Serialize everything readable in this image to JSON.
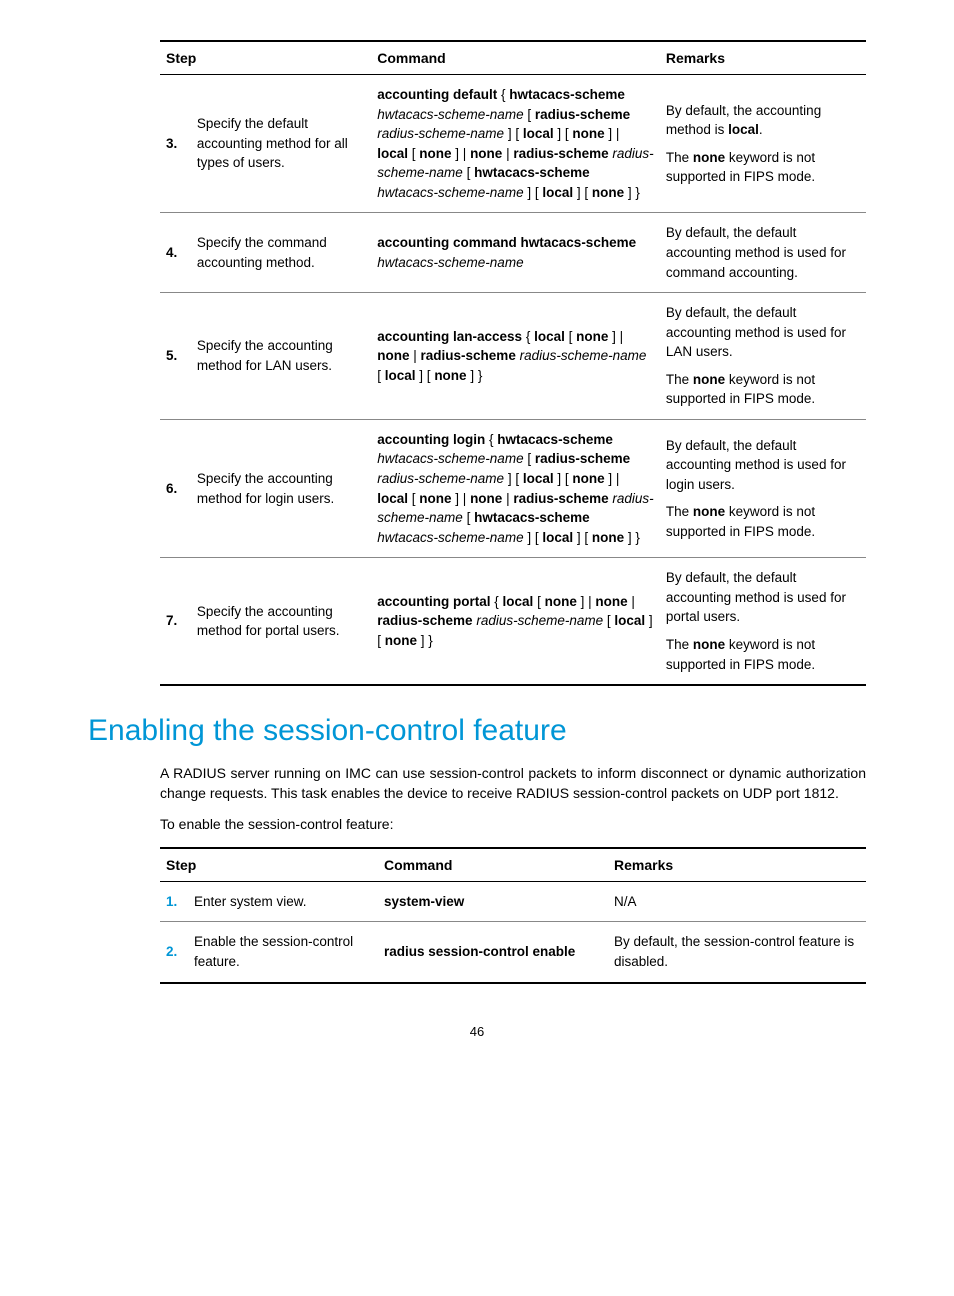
{
  "table1": {
    "headers": {
      "step": "Step",
      "command": "Command",
      "remarks": "Remarks"
    },
    "rows": [
      {
        "num": "3.",
        "desc": "Specify the default accounting method for all types of users.",
        "cmd_segments": [
          {
            "t": "accounting default",
            "b": true
          },
          {
            "t": " { "
          },
          {
            "t": "hwtacacs-scheme",
            "b": true
          },
          {
            "t": " "
          },
          {
            "t": "hwtacacs-scheme-name",
            "i": true
          },
          {
            "t": " [ "
          },
          {
            "t": "radius-scheme",
            "b": true
          },
          {
            "t": " "
          },
          {
            "t": "radius-scheme-name",
            "i": true
          },
          {
            "t": " ] [ "
          },
          {
            "t": "local",
            "b": true
          },
          {
            "t": " ] [ "
          },
          {
            "t": "none",
            "b": true
          },
          {
            "t": " ] | "
          },
          {
            "t": "local",
            "b": true
          },
          {
            "t": " [ "
          },
          {
            "t": "none",
            "b": true
          },
          {
            "t": " ] | "
          },
          {
            "t": "none",
            "b": true
          },
          {
            "t": " | "
          },
          {
            "t": "radius-scheme",
            "b": true
          },
          {
            "t": " "
          },
          {
            "t": "radius-scheme-name",
            "i": true
          },
          {
            "t": " [ "
          },
          {
            "t": "hwtacacs-scheme",
            "b": true
          },
          {
            "t": " "
          },
          {
            "t": "hwtacacs-scheme-name",
            "i": true
          },
          {
            "t": " ] [ "
          },
          {
            "t": "local",
            "b": true
          },
          {
            "t": " ] [ "
          },
          {
            "t": "none",
            "b": true
          },
          {
            "t": " ] }"
          }
        ],
        "remarks": [
          [
            {
              "t": "By default, the accounting method is "
            },
            {
              "t": "local",
              "b": true
            },
            {
              "t": "."
            }
          ],
          [
            {
              "t": "The "
            },
            {
              "t": "none",
              "b": true
            },
            {
              "t": " keyword is not supported in FIPS mode."
            }
          ]
        ]
      },
      {
        "num": "4.",
        "desc": "Specify the command accounting method.",
        "cmd_segments": [
          {
            "t": "accounting command hwtacacs-scheme",
            "b": true
          },
          {
            "t": " "
          },
          {
            "t": "hwtacacs-scheme-name",
            "i": true
          }
        ],
        "remarks": [
          [
            {
              "t": "By default, the default accounting method is used for command accounting."
            }
          ]
        ]
      },
      {
        "num": "5.",
        "desc": "Specify the accounting method for LAN users.",
        "cmd_segments": [
          {
            "t": "accounting lan-access",
            "b": true
          },
          {
            "t": " { "
          },
          {
            "t": "local",
            "b": true
          },
          {
            "t": " [ "
          },
          {
            "t": "none",
            "b": true
          },
          {
            "t": " ] | "
          },
          {
            "t": "none",
            "b": true
          },
          {
            "t": " | "
          },
          {
            "t": "radius-scheme",
            "b": true
          },
          {
            "t": " "
          },
          {
            "t": "radius-scheme-name",
            "i": true
          },
          {
            "t": " [ "
          },
          {
            "t": "local",
            "b": true
          },
          {
            "t": " ] [ "
          },
          {
            "t": "none",
            "b": true
          },
          {
            "t": " ] }"
          }
        ],
        "remarks": [
          [
            {
              "t": "By default, the default accounting method is used for LAN users."
            }
          ],
          [
            {
              "t": "The "
            },
            {
              "t": "none",
              "b": true
            },
            {
              "t": " keyword is not supported in FIPS mode."
            }
          ]
        ]
      },
      {
        "num": "6.",
        "desc": "Specify the accounting method for login users.",
        "cmd_segments": [
          {
            "t": "accounting login",
            "b": true
          },
          {
            "t": " { "
          },
          {
            "t": "hwtacacs-scheme",
            "b": true
          },
          {
            "t": " "
          },
          {
            "t": "hwtacacs-scheme-name",
            "i": true
          },
          {
            "t": " [ "
          },
          {
            "t": "radius-scheme",
            "b": true
          },
          {
            "t": " "
          },
          {
            "t": "radius-scheme-name",
            "i": true
          },
          {
            "t": " ] [ "
          },
          {
            "t": "local",
            "b": true
          },
          {
            "t": " ] [ "
          },
          {
            "t": "none",
            "b": true
          },
          {
            "t": " ] | "
          },
          {
            "t": "local",
            "b": true
          },
          {
            "t": " [ "
          },
          {
            "t": "none",
            "b": true
          },
          {
            "t": " ] | "
          },
          {
            "t": "none",
            "b": true
          },
          {
            "t": " | "
          },
          {
            "t": "radius-scheme",
            "b": true
          },
          {
            "t": " "
          },
          {
            "t": "radius-scheme-name",
            "i": true
          },
          {
            "t": " [ "
          },
          {
            "t": "hwtacacs-scheme",
            "b": true
          },
          {
            "t": " "
          },
          {
            "t": "hwtacacs-scheme-name",
            "i": true
          },
          {
            "t": " ] [ "
          },
          {
            "t": "local",
            "b": true
          },
          {
            "t": " ] [ "
          },
          {
            "t": "none",
            "b": true
          },
          {
            "t": " ] }"
          }
        ],
        "remarks": [
          [
            {
              "t": "By default, the default accounting method is used for login users."
            }
          ],
          [
            {
              "t": "The "
            },
            {
              "t": "none",
              "b": true
            },
            {
              "t": " keyword is not supported in FIPS mode."
            }
          ]
        ]
      },
      {
        "num": "7.",
        "desc": "Specify the accounting method for portal users.",
        "cmd_segments": [
          {
            "t": "accounting portal",
            "b": true
          },
          {
            "t": " { "
          },
          {
            "t": "local",
            "b": true
          },
          {
            "t": " [ "
          },
          {
            "t": "none",
            "b": true
          },
          {
            "t": " ] | "
          },
          {
            "t": "none",
            "b": true
          },
          {
            "t": " | "
          },
          {
            "t": "radius-scheme",
            "b": true
          },
          {
            "t": " "
          },
          {
            "t": "radius-scheme-name",
            "i": true
          },
          {
            "t": " [ "
          },
          {
            "t": "local",
            "b": true
          },
          {
            "t": " ] [ "
          },
          {
            "t": "none",
            "b": true
          },
          {
            "t": " ] }"
          }
        ],
        "remarks": [
          [
            {
              "t": "By default, the default accounting method is used for portal users."
            }
          ],
          [
            {
              "t": "The "
            },
            {
              "t": "none",
              "b": true
            },
            {
              "t": " keyword is not supported in FIPS mode."
            }
          ]
        ]
      }
    ]
  },
  "heading": "Enabling the session-control feature",
  "intro1": "A RADIUS server running on IMC can use session-control packets to inform disconnect or dynamic authorization change requests. This task enables the device to receive RADIUS session-control packets on UDP port 1812.",
  "intro2": "To enable the session-control feature:",
  "table2": {
    "headers": {
      "step": "Step",
      "command": "Command",
      "remarks": "Remarks"
    },
    "rows": [
      {
        "num": "1.",
        "desc": "Enter system view.",
        "cmd_segments": [
          {
            "t": "system-view",
            "b": true
          }
        ],
        "remarks": [
          [
            {
              "t": "N/A"
            }
          ]
        ]
      },
      {
        "num": "2.",
        "desc": "Enable the session-control feature.",
        "cmd_segments": [
          {
            "t": "radius session-control enable",
            "b": true
          }
        ],
        "remarks": [
          [
            {
              "t": "By default, the session-control feature is disabled."
            }
          ]
        ]
      }
    ]
  },
  "page_number": "46"
}
